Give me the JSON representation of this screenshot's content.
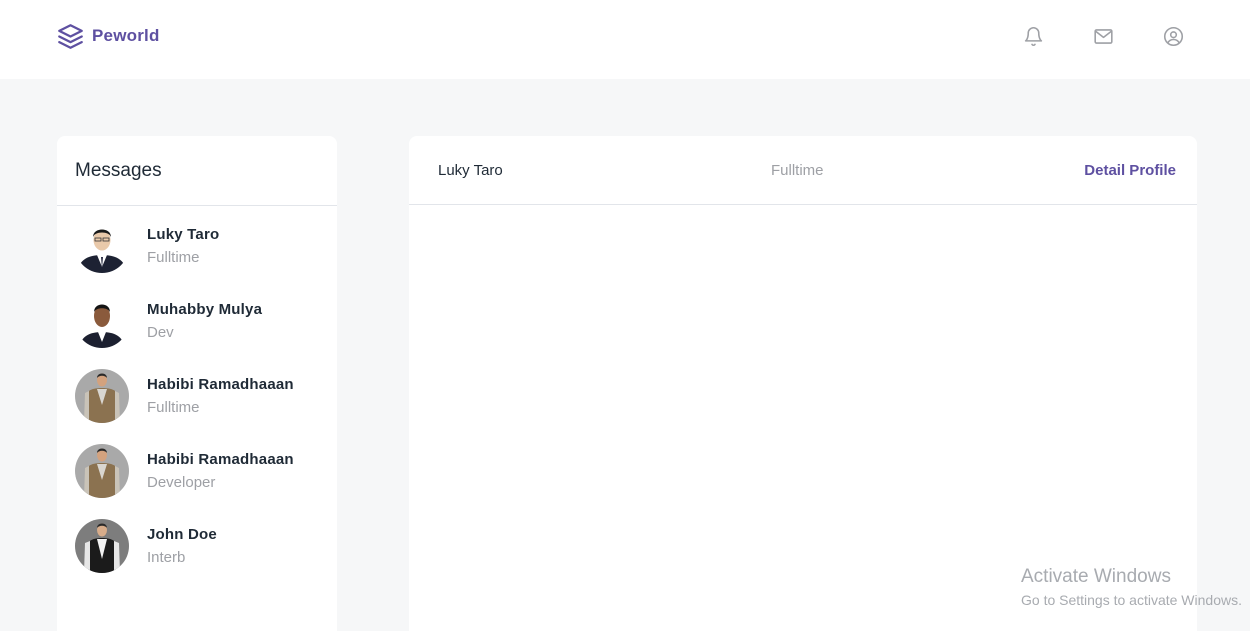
{
  "header": {
    "brand": "Peworld",
    "icons": [
      "bell-icon",
      "mail-icon",
      "user-circle-icon"
    ],
    "brand_color": "#5e50a1"
  },
  "messages": {
    "title": "Messages",
    "contacts": [
      {
        "name": "Luky Taro",
        "role": "Fulltime"
      },
      {
        "name": "Muhabby Mulya",
        "role": "Dev"
      },
      {
        "name": "Habibi Ramadhaaan",
        "role": "Fulltime"
      },
      {
        "name": "Habibi Ramadhaaan",
        "role": "Developer"
      },
      {
        "name": "John Doe",
        "role": "Interb"
      }
    ]
  },
  "chat": {
    "name": "Luky Taro",
    "role": "Fulltime",
    "detail_link": "Detail Profile"
  },
  "watermark": {
    "title": "Activate Windows",
    "subtitle": "Go to Settings to activate Windows."
  }
}
